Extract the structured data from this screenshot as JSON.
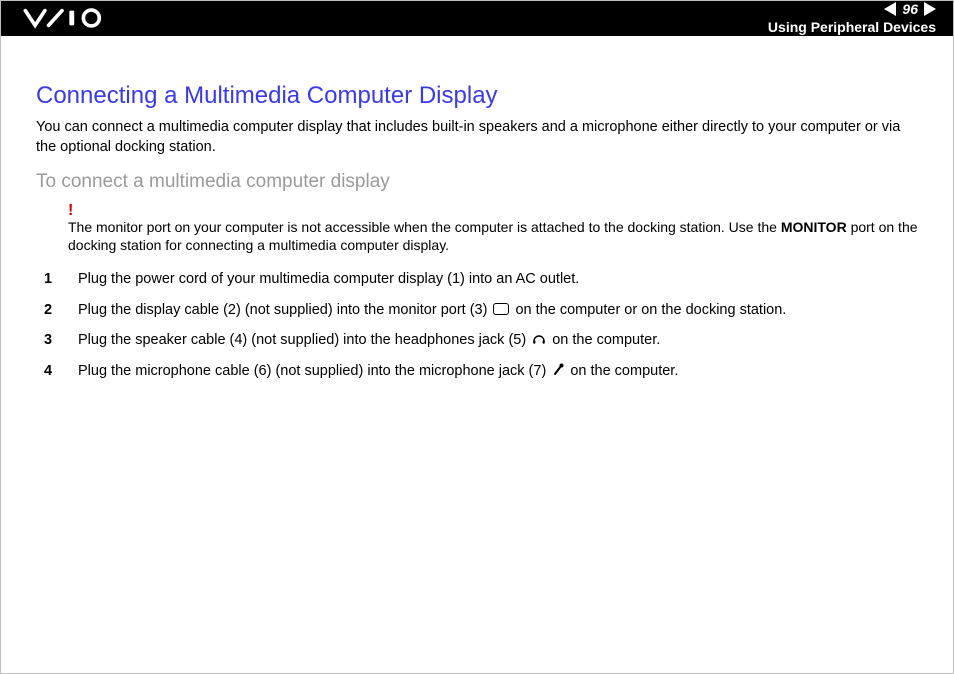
{
  "header": {
    "page_number": "96",
    "section": "Using Peripheral Devices"
  },
  "title": "Connecting a Multimedia Computer Display",
  "intro": "You can connect a multimedia computer display that includes built-in speakers and a microphone either directly to your computer or via the optional docking station.",
  "subhead": "To connect a multimedia computer display",
  "note": {
    "pre": "The monitor port on your computer is not accessible when the computer is attached to the docking station. Use the ",
    "bold": "MONITOR",
    "post": " port on the docking station for connecting a multimedia computer display."
  },
  "steps": {
    "s1": "Plug the power cord of your multimedia computer display (1) into an AC outlet.",
    "s2a": "Plug the display cable (2) (not supplied) into the monitor port (3) ",
    "s2b": " on the computer or on the docking station.",
    "s3a": "Plug the speaker cable (4) (not supplied) into the headphones jack (5) ",
    "s3b": " on the computer.",
    "s4a": "Plug the microphone cable (6) (not supplied) into the microphone jack (7) ",
    "s4b": " on the computer."
  }
}
